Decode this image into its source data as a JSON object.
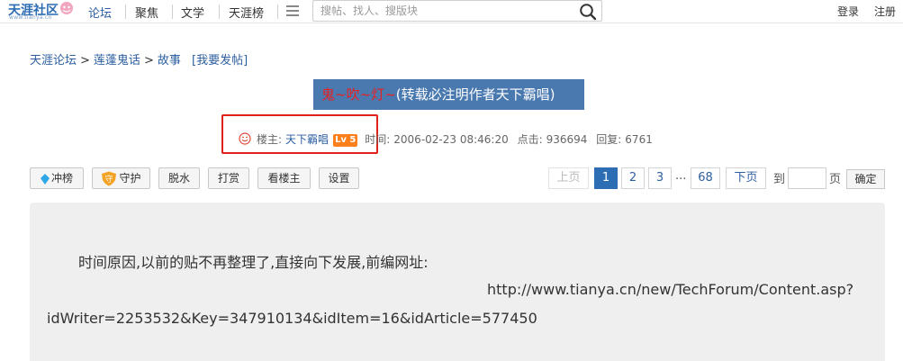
{
  "header": {
    "logo_text": "天涯社区",
    "logo_url": "www.tianya.cn",
    "nav": [
      "论坛",
      "聚焦",
      "文学",
      "天涯榜"
    ],
    "search_placeholder": "搜帖、找人、搜版块",
    "login": "登录",
    "register": "注册"
  },
  "breadcrumb": {
    "items": [
      "天涯论坛",
      "莲蓬鬼话",
      "故事"
    ],
    "separator": ">",
    "post_link": "[我要发帖]"
  },
  "post": {
    "title_red": "鬼~吹~灯~",
    "title_rest": "(转载必注明作者天下霸唱)",
    "owner_label": "楼主:",
    "author": "天下霸唱",
    "level": "Lv 5",
    "time_label": "时间:",
    "time": "2006-02-23 08:46:20",
    "clicks_label": "点击:",
    "clicks": "936694",
    "replies_label": "回复:",
    "replies": "6761"
  },
  "toolbar": {
    "chongbang": "冲榜",
    "shouhu": "守护",
    "tuoshui": "脱水",
    "dashang": "打赏",
    "kanlouzhu": "看楼主",
    "shezhi": "设置"
  },
  "pager": {
    "prev": "上页",
    "pages": [
      "1",
      "2",
      "3"
    ],
    "dots": "...",
    "last": "68",
    "next": "下页",
    "goto_label": "到",
    "page_unit": "页",
    "confirm": "确定"
  },
  "content": {
    "line1": "时间原因,以前的贴不再整理了,直接向下发展,前编网址:",
    "line2": "http://www.tianya.cn/new/TechForum/Content.asp?",
    "line3": "idWriter=2253532&Key=347910134&idItem=16&idArticle=577450"
  },
  "colors": {
    "brand_blue": "#2d6db3",
    "title_bg": "#4a79b0",
    "title_red": "#e82020",
    "level_badge": "#ff7f1a",
    "highlight_box": "#e0201a"
  }
}
